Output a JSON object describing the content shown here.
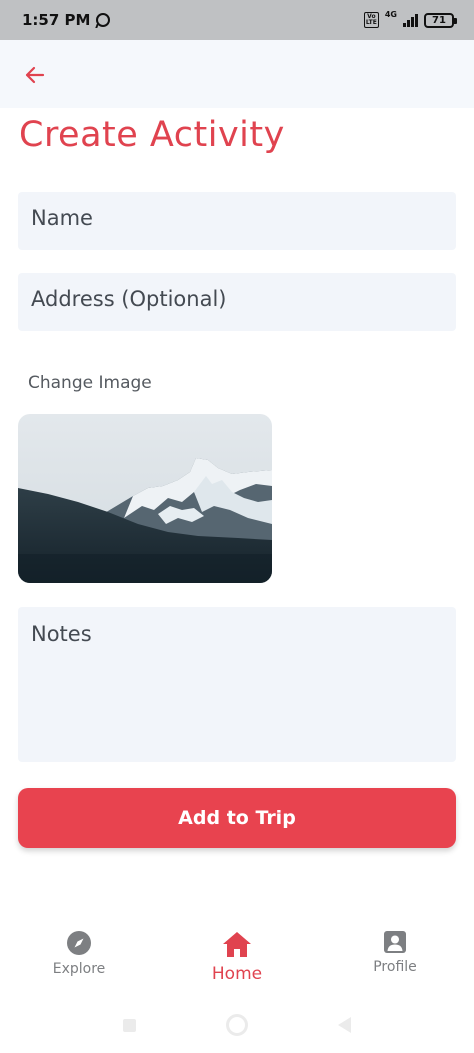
{
  "status_bar": {
    "time": "1:57 PM",
    "volte": "Vo\nLTE",
    "network": "4G",
    "battery": "71"
  },
  "header": {
    "back_icon": "arrow-left-icon",
    "title": "Create Activity"
  },
  "form": {
    "name_placeholder": "Name",
    "address_placeholder": "Address (Optional)",
    "change_image_label": "Change Image",
    "notes_placeholder": "Notes",
    "submit_label": "Add to Trip"
  },
  "bottom_nav": {
    "items": [
      {
        "label": "Explore",
        "icon": "compass-icon",
        "active": false
      },
      {
        "label": "Home",
        "icon": "home-icon",
        "active": true
      },
      {
        "label": "Profile",
        "icon": "profile-icon",
        "active": false
      }
    ]
  },
  "colors": {
    "accent": "#e0434f",
    "field_bg": "#f2f5fa",
    "inactive": "#7d7f82"
  }
}
